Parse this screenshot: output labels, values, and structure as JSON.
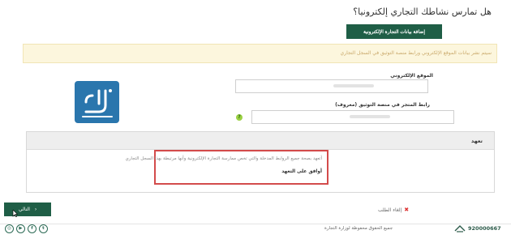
{
  "header": {
    "question": "هل تمارس نشاطك التجاري إلكترونيا؟"
  },
  "store": {
    "add_button_label": "إضافة بيانات التجارة الإلكترونية"
  },
  "notice": {
    "text": "سيتم نشر بيانات الموقع الإلكتروني ورابط منصة التوثيق في السجل التجاري"
  },
  "form": {
    "website_label": "الموقع الإلكتروني",
    "website_value": "",
    "link_label": "رابط المتجر في منصة التوثيق (معروف)",
    "link_value": "",
    "help_glyph": "?"
  },
  "pledge": {
    "heading": "تعهد",
    "text": "أتعهد بصحة جميع الروابط المدخلة والتي تخص ممارسة التجارة الإلكترونية وأنها مرتبطة بهذا السجل التجاري",
    "agree_label": "أوافق على التعهد"
  },
  "actions": {
    "next_label": "التالي",
    "next_glyph": "›",
    "cancel_label": "إلغاء الطلب",
    "cancel_glyph": "✖"
  },
  "footer": {
    "copyright": "جميع الحقوق محفوظة لوزارة التجارة",
    "phone": "920000667",
    "socials": [
      {
        "icon": "instagram-icon",
        "glyph": "◎"
      },
      {
        "icon": "youtube-icon",
        "glyph": "▶"
      },
      {
        "icon": "facebook-icon",
        "glyph": "f"
      },
      {
        "icon": "twitter-icon",
        "glyph": "t"
      }
    ]
  },
  "colors": {
    "brand_green": "#1f5e46",
    "notice_bg": "#fcf6dd",
    "highlight_red": "#d34b4b",
    "logo_blue": "#2a76ad"
  }
}
